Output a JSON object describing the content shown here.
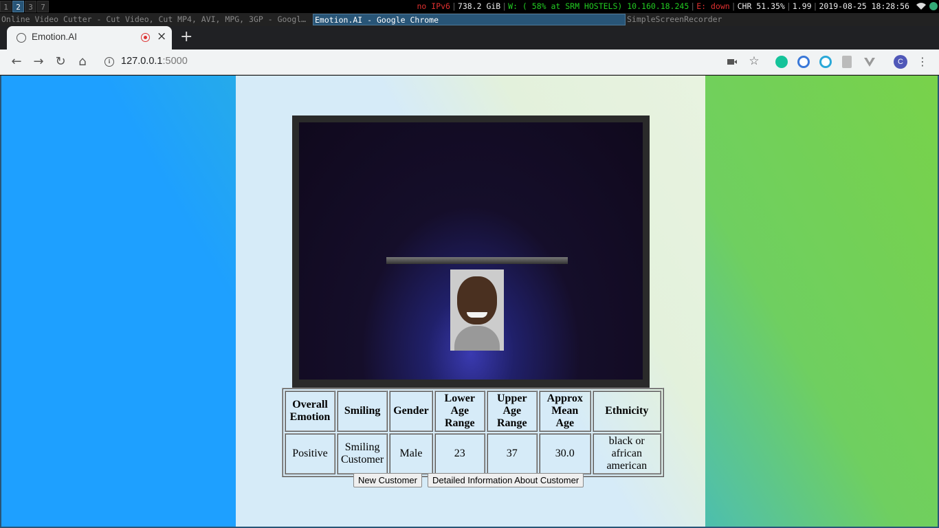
{
  "statusbar": {
    "workspaces": [
      "1",
      "2",
      "3",
      "7"
    ],
    "ipv6": "no IPv6",
    "disk": "738.2 GiB",
    "wifi": "W: ( 58% at SRM HOSTELS) 10.160.18.245",
    "ethernet": "E: down",
    "battery": "CHR 51.35%",
    "load": "1.99",
    "datetime": "2019-08-25 18:28:56"
  },
  "window_tabs": [
    "Online Video Cutter - Cut Video, Cut MP4, AVI, MPG, 3GP - Googl…",
    "Emotion.AI - Google Chrome",
    "SimpleScreenRecorder"
  ],
  "browser": {
    "tab_title": "Emotion.AI",
    "url_host": "127.0.0.1",
    "url_port": ":5000",
    "avatar_letter": "C"
  },
  "results": {
    "headers": [
      "Overall Emotion",
      "Smiling",
      "Gender",
      "Lower Age Range",
      "Upper Age Range",
      "Approx Mean Age",
      "Ethnicity"
    ],
    "row": [
      "Positive",
      "Smiling Customer",
      "Male",
      "23",
      "37",
      "30.0",
      "black or african american"
    ]
  },
  "buttons": {
    "new_customer": "New Customer",
    "details": "Detailed Information About Customer"
  },
  "colors": {
    "workspace_active": "#285577",
    "chrome_dark": "#202124",
    "toolbar": "#f1f3f4",
    "page_left": "#1ea0ff",
    "page_right": "#78d24a"
  }
}
